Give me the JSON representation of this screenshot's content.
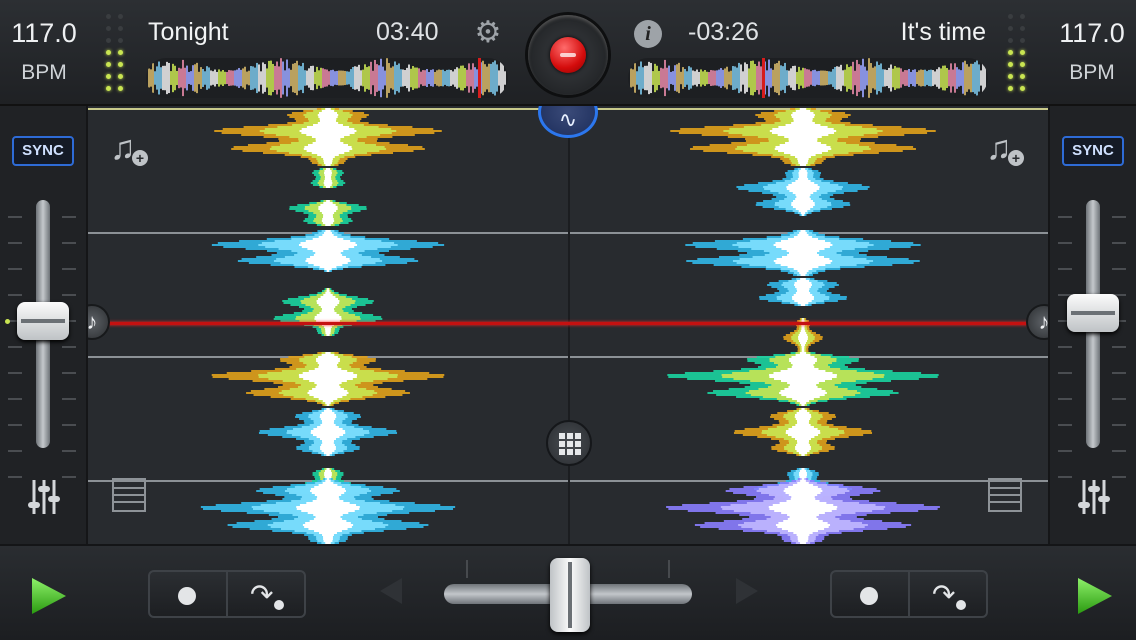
{
  "left_deck": {
    "bpm": "117.0",
    "bpm_unit": "BPM",
    "title": "Tonight",
    "time": "03:40",
    "sync_label": "SYNC"
  },
  "right_deck": {
    "bpm": "117.0",
    "bpm_unit": "BPM",
    "title": "It's time",
    "time": "-03:26",
    "sync_label": "SYNC"
  },
  "colors": {
    "accent_blue": "#2c77ee",
    "record_red": "#d40c0c",
    "play_green": "#3ec21c",
    "vu_green": "#c9e552",
    "playhead_red": "#c51111"
  },
  "icons": {
    "settings": "gear-icon",
    "info": "info-icon",
    "record": "record-icon",
    "waveform_mode": "waveform-icon",
    "add_track": "music-note-add-icon",
    "cue": "music-note-icon",
    "library": "list-icon",
    "pads": "grid-icon",
    "mixer": "equalizer-sliders-icon",
    "play": "play-icon",
    "loop_dot": "dot-icon",
    "redo": "redo-arrow-icon"
  },
  "crossfader_position": 0.5,
  "left_pitch_position": 0.48,
  "right_pitch_position": 0.44
}
